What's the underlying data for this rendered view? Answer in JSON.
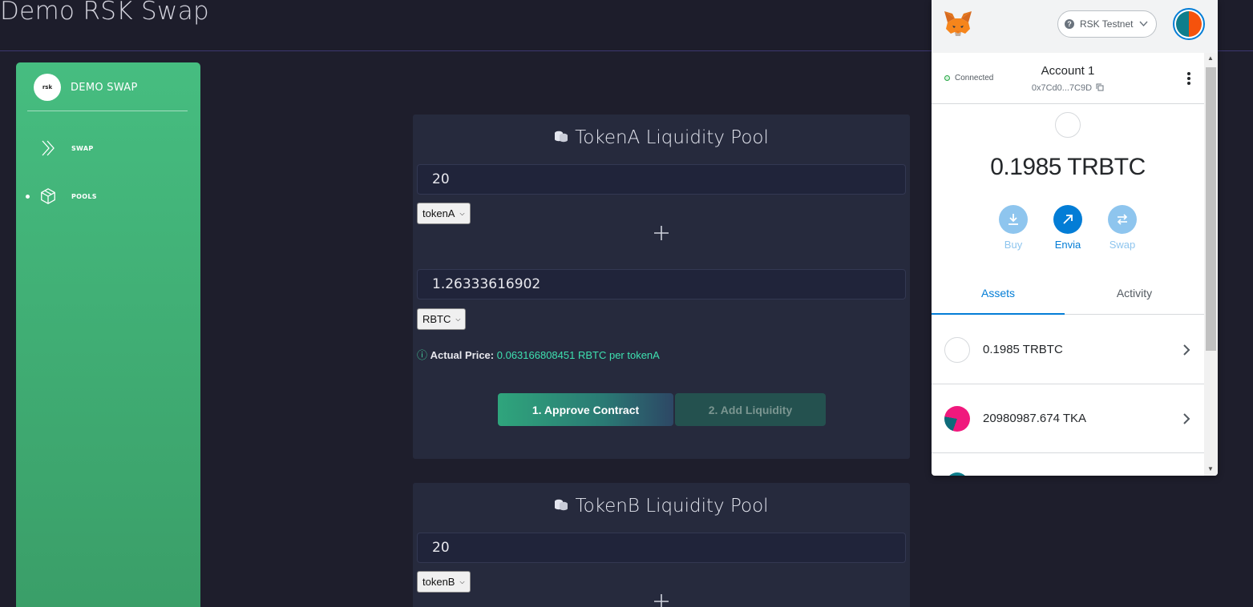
{
  "app": {
    "title": "Demo RSK Swap"
  },
  "sidebar": {
    "brand_logo_text": "rsk",
    "brand_name": "DEMO SWAP",
    "items": [
      {
        "label": "SWAP",
        "icon": "double-chevron-right-icon",
        "active": false
      },
      {
        "label": "POOLS",
        "icon": "cube-icon",
        "active": true
      }
    ]
  },
  "pools": [
    {
      "title": "TokenA Liquidity Pool",
      "amount1": "20",
      "token1": "tokenA",
      "amount2": "1.26333616902",
      "token2": "RBTC",
      "price_icon": "ⓘ",
      "price_label": "Actual Price:",
      "price_value": "0.063166808451 RBTC per tokenA",
      "approve_label": "1. Approve Contract",
      "add_label": "2. Add Liquidity"
    },
    {
      "title": "TokenB Liquidity Pool",
      "amount1": "20",
      "token1": "tokenB"
    }
  ],
  "metamask": {
    "network": "RSK Testnet",
    "network_icon_text": "?",
    "connected_label": "Connected",
    "account_name": "Account 1",
    "address": "0x7Cd0...7C9D",
    "balance": "0.1985 TRBTC",
    "actions": [
      {
        "label": "Buy",
        "icon": "download-icon",
        "color": "#8ec5ee"
      },
      {
        "label": "Envia",
        "icon": "send-arrow-icon",
        "color": "#037dd6"
      },
      {
        "label": "Swap",
        "icon": "swap-icon",
        "color": "#8ec5ee"
      }
    ],
    "tabs": [
      {
        "label": "Assets",
        "active": true
      },
      {
        "label": "Activity",
        "active": false
      }
    ],
    "assets": [
      {
        "label": "0.1985 TRBTC"
      },
      {
        "label": "20980987.674 TKA"
      }
    ]
  },
  "colors": {
    "accent_green": "#46bd80",
    "metamask_blue": "#037dd6",
    "background": "#1e1e2c",
    "card": "#262a3d"
  }
}
